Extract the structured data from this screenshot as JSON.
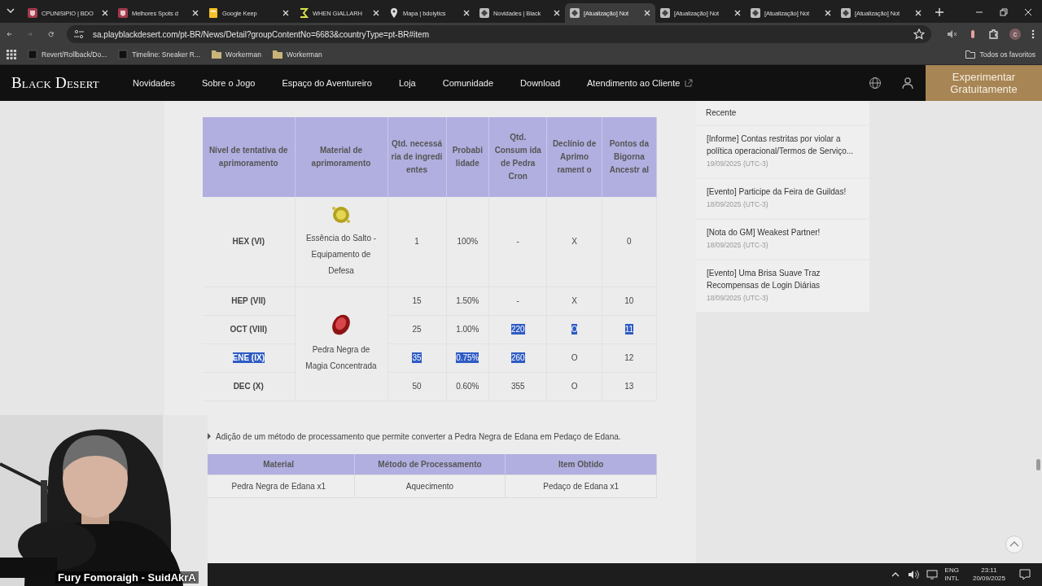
{
  "browser": {
    "tabs": [
      {
        "title": "CPUNISiPIO | BDO",
        "selected": false
      },
      {
        "title": "Melhores Spots d",
        "selected": false
      },
      {
        "title": "Google Keep",
        "selected": false
      },
      {
        "title": "WHEN GIALLARH",
        "selected": false
      },
      {
        "title": "Mapa | bdolytics",
        "selected": false
      },
      {
        "title": "Novidades | Black",
        "selected": false
      },
      {
        "title": "[Atualização] Not",
        "selected": true
      },
      {
        "title": "[Atualização] Not",
        "selected": false
      },
      {
        "title": "[Atualização] Not",
        "selected": false
      },
      {
        "title": "[Atualização] Not",
        "selected": false
      }
    ],
    "url": "sa.playblackdesert.com/pt-BR/News/Detail?groupContentNo=6683&countryType=pt-BR#item",
    "profile": "c",
    "bookmarks": [
      "Revert/Rollback/Do...",
      "Timeline: Sneaker R...",
      "Workerman",
      "Workerman"
    ],
    "all_bookmarks": "Todos os favoritos"
  },
  "site": {
    "logo": "Black Desert",
    "nav": [
      {
        "label": "Novidades",
        "external": false
      },
      {
        "label": "Sobre o Jogo",
        "external": false
      },
      {
        "label": "Espaço do Aventureiro",
        "external": false
      },
      {
        "label": "Loja",
        "external": false
      },
      {
        "label": "Comunidade",
        "external": false
      },
      {
        "label": "Download",
        "external": false
      },
      {
        "label": "Atendimento ao Cliente",
        "external": true
      }
    ],
    "cta": "Experimentar Gratuitamente"
  },
  "table": {
    "columns": [
      "Nível de tentativa de aprimoramento",
      "Material de aprimoramento",
      "Qtd. necessá ria de ingredi entes",
      "Probabi lidade",
      "Qtd. Consum ida de Pedra Cron",
      "Declínio de Aprimo rament o",
      "Pontos da Bigorna Ancestr al"
    ],
    "groups": [
      {
        "material": "Essência do Salto - Equipamento de Defesa",
        "rows": [
          [
            {
              "text": "HEX (VI)",
              "selected": false
            },
            {
              "text": "1",
              "selected": false
            },
            {
              "text": "100%",
              "selected": false
            },
            {
              "text": "-",
              "selected": false
            },
            {
              "text": "X",
              "selected": false
            },
            {
              "text": "0",
              "selected": false
            }
          ]
        ]
      },
      {
        "material": "Pedra Negra de Magia Concentrada",
        "rows": [
          [
            {
              "text": "HEP (VII)",
              "selected": false
            },
            {
              "text": "15",
              "selected": false
            },
            {
              "text": "1.50%",
              "selected": false
            },
            {
              "text": "-",
              "selected": false
            },
            {
              "text": "X",
              "selected": false
            },
            {
              "text": "10",
              "selected": false
            }
          ],
          [
            {
              "text": "OCT (VIII)",
              "selected": false
            },
            {
              "text": "25",
              "selected": false
            },
            {
              "text": "1.00%",
              "selected": false
            },
            {
              "text": "220",
              "selected": true
            },
            {
              "text": "O",
              "selected": true
            },
            {
              "text": "11",
              "selected": true
            }
          ],
          [
            {
              "text": "ENE (IX)",
              "selected": true
            },
            {
              "text": "35",
              "selected": true
            },
            {
              "text": "0.75%",
              "selected": true
            },
            {
              "text": "260",
              "selected": true
            },
            {
              "text": "O",
              "selected": false
            },
            {
              "text": "12",
              "selected": false
            }
          ],
          [
            {
              "text": "DEC (X)",
              "selected": false
            },
            {
              "text": "50",
              "selected": false
            },
            {
              "text": "0.60%",
              "selected": false
            },
            {
              "text": "355",
              "selected": false
            },
            {
              "text": "O",
              "selected": false
            },
            {
              "text": "13",
              "selected": false
            }
          ]
        ]
      }
    ]
  },
  "note": "Adição de um método de processamento que permite converter a Pedra Negra de Edana em Pedaço de Edana.",
  "processing_table": {
    "columns": [
      "Material",
      "Método de Processamento",
      "Item Obtido"
    ],
    "rows": [
      [
        "Pedra Negra de Edana x1",
        "Aquecimento",
        "Pedaço de Edana x1"
      ]
    ]
  },
  "sidebar": {
    "title": "Recente",
    "items": [
      {
        "title": "[Informe] Contas restritas por violar a política operacional/Termos de Serviço...",
        "date": "19/09/2025 (UTC-3)"
      },
      {
        "title": "[Evento] Participe da Feira de Guildas!",
        "date": "18/09/2025 (UTC-3)"
      },
      {
        "title": "[Nota do GM] Weakest Partner!",
        "date": "18/09/2025 (UTC-3)"
      },
      {
        "title": "[Evento] Uma Brisa Suave Traz Recompensas de Login Diárias",
        "date": "18/09/2025 (UTC-3)"
      }
    ]
  },
  "webcam": {
    "kind": "picture",
    "caption": "Fury Fomoraigh - SuidAkrA"
  },
  "taskbar": {
    "language": "ENG",
    "layout": "INTL",
    "time": "23:11",
    "date": "20/09/2025"
  }
}
